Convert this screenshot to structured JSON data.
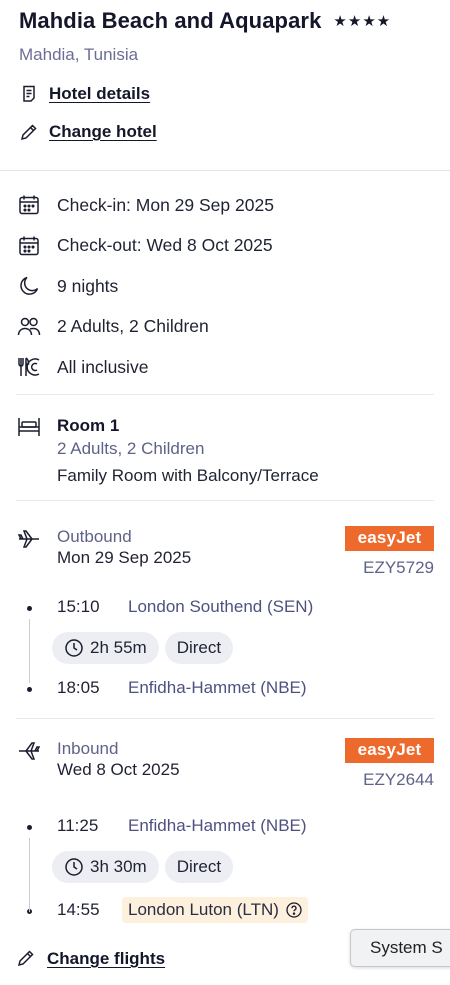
{
  "hotel": {
    "name": "Mahdia Beach and Aquapark",
    "stars": "★★★★",
    "location": "Mahdia, Tunisia",
    "details_link": "Hotel details",
    "change_link": "Change hotel"
  },
  "stay": {
    "check_in": "Check-in: Mon 29 Sep 2025",
    "check_out": "Check-out: Wed 8 Oct 2025",
    "nights": "9 nights",
    "guests": "2 Adults, 2 Children",
    "board": "All inclusive"
  },
  "room": {
    "title": "Room 1",
    "occupancy": "2 Adults, 2 Children",
    "type": "Family Room with Balcony/Terrace"
  },
  "outbound": {
    "label": "Outbound",
    "date": "Mon 29 Sep 2025",
    "airline": "easyJet",
    "flight_no": "EZY5729",
    "depart_time": "15:10",
    "depart_airport": "London Southend (SEN)",
    "duration": "2h 55m",
    "stops": "Direct",
    "arrive_time": "18:05",
    "arrive_airport": "Enfidha-Hammet (NBE)"
  },
  "inbound": {
    "label": "Inbound",
    "date": "Wed 8 Oct 2025",
    "airline": "easyJet",
    "flight_no": "EZY2644",
    "depart_time": "11:25",
    "depart_airport": "Enfidha-Hammet (NBE)",
    "duration": "3h 30m",
    "stops": "Direct",
    "arrive_time": "14:55",
    "arrive_airport": "London Luton (LTN)"
  },
  "change_flights": "Change flights",
  "tooltip": "System S",
  "colors": {
    "easyjet": "#ee6a2c",
    "muted_text": "#6b6e95",
    "highlight": "#fdf0dc"
  }
}
